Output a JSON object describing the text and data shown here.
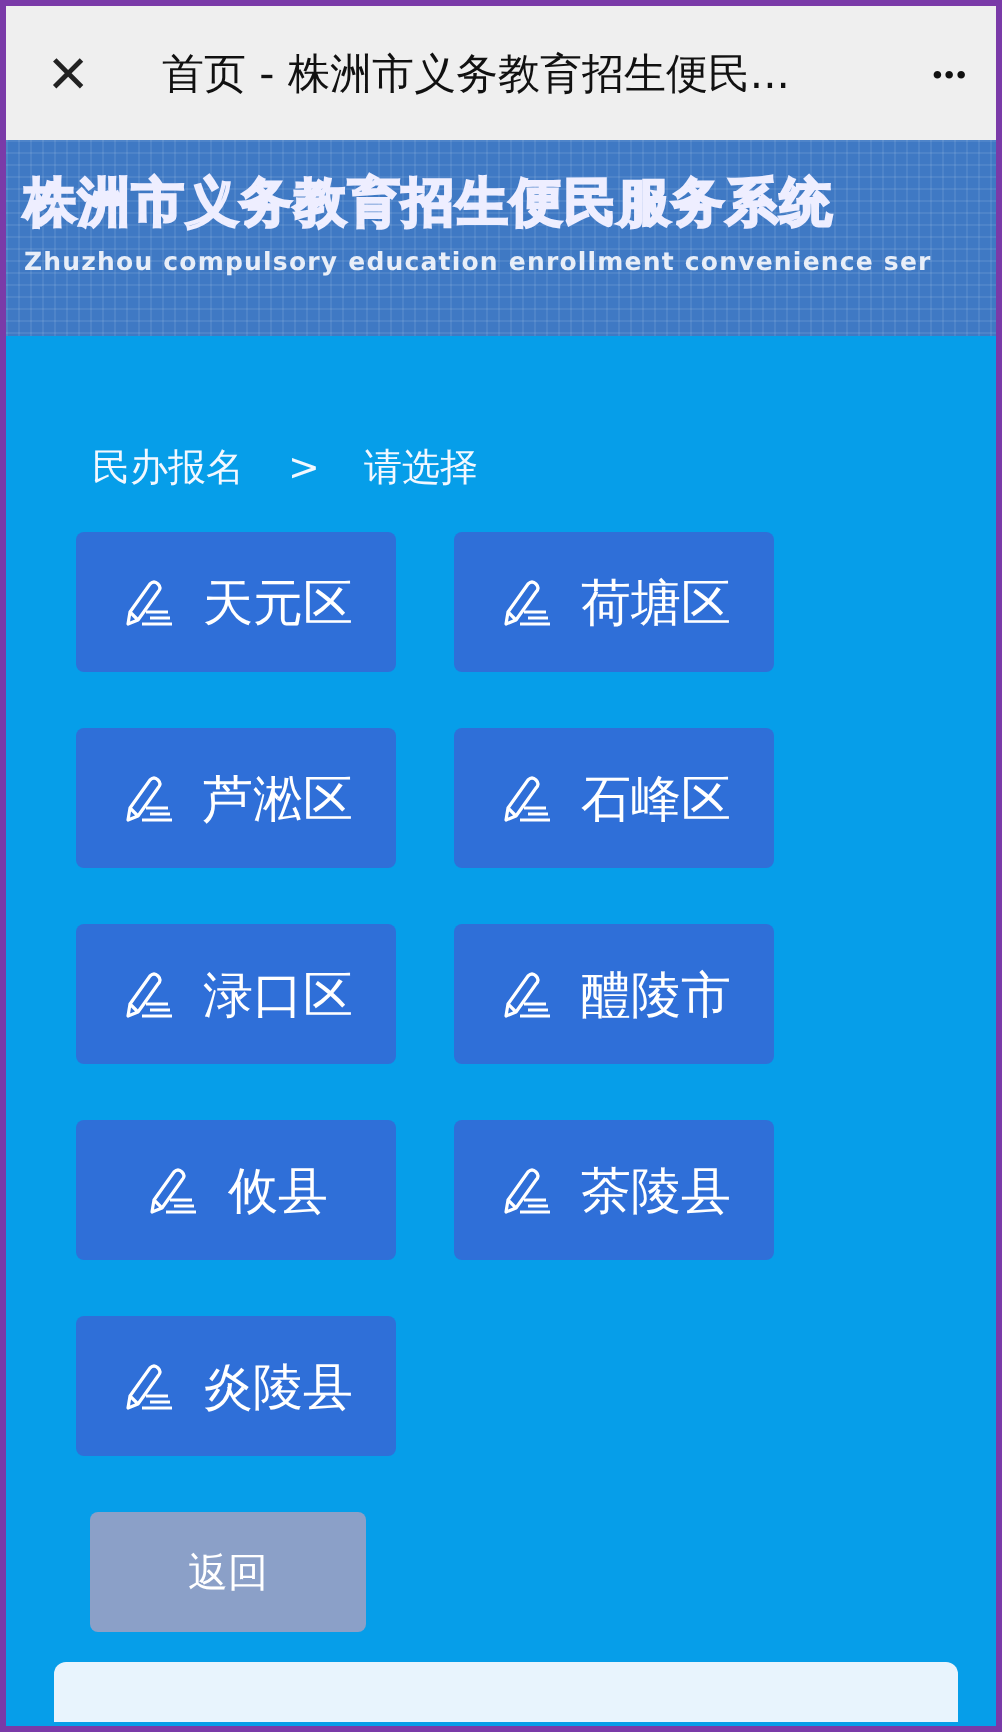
{
  "topbar": {
    "close": "×",
    "title": "首页 - 株洲市义务教育招生便民...",
    "more": "•••"
  },
  "banner": {
    "title": "株洲市义务教育招生便民服务系统",
    "subtitle": "Zhuzhou compulsory education enrollment convenience ser"
  },
  "breadcrumb": [
    "民办报名",
    ">",
    "请选择"
  ],
  "districts": [
    {
      "label": "天元区"
    },
    {
      "label": "荷塘区"
    },
    {
      "label": "芦淞区"
    },
    {
      "label": "石峰区"
    },
    {
      "label": "渌口区"
    },
    {
      "label": "醴陵市"
    },
    {
      "label": "攸县"
    },
    {
      "label": "茶陵县"
    },
    {
      "label": "炎陵县"
    }
  ],
  "back_button": "返回"
}
